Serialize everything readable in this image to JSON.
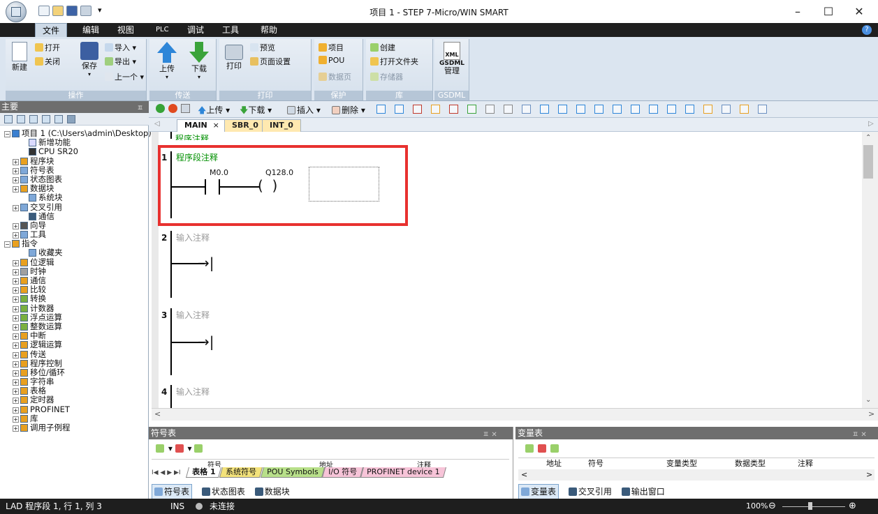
{
  "window": {
    "title": "项目 1 - STEP 7-Micro/WIN SMART",
    "minimize": "–",
    "maximize": "☐",
    "close": "✕"
  },
  "menu": [
    "文件",
    "编辑",
    "视图",
    "PLC",
    "调试",
    "工具",
    "帮助"
  ],
  "ribbon": {
    "operate": {
      "new": "新建",
      "open": "打开",
      "close": "关闭",
      "save": "保存",
      "import": "导入",
      "export": "导出",
      "prev": "上一个",
      "title": "操作"
    },
    "transfer": {
      "upload": "上传",
      "download": "下载",
      "title": "传送"
    },
    "print": {
      "print": "打印",
      "preview": "预览",
      "page_setup": "页面设置",
      "title": "打印"
    },
    "protect": {
      "project": "项目",
      "pou": "POU",
      "data_page": "数据页",
      "title": "保护"
    },
    "library": {
      "create": "创建",
      "open_folder": "打开文件夹",
      "memory": "存储器",
      "title": "库"
    },
    "gsdml": {
      "xml": "XML",
      "manage_line1": "GSDML",
      "manage_line2": "管理",
      "title": "GSDML"
    }
  },
  "left_panel": {
    "title": "主要",
    "tree": [
      {
        "label": "项目 1 (C:\\Users\\admin\\Desktop)",
        "level": 0,
        "toggle": "−",
        "color": "#3a7fd0"
      },
      {
        "label": "新增功能",
        "level": 2,
        "toggle": "",
        "color": "#d9d9ff"
      },
      {
        "label": "CPU SR20",
        "level": 2,
        "toggle": "",
        "color": "#333333"
      },
      {
        "label": "程序块",
        "level": 1,
        "toggle": "+",
        "color": "#e8a020"
      },
      {
        "label": "符号表",
        "level": 1,
        "toggle": "+",
        "color": "#7fa8d8"
      },
      {
        "label": "状态图表",
        "level": 1,
        "toggle": "+",
        "color": "#7fa8d8"
      },
      {
        "label": "数据块",
        "level": 1,
        "toggle": "+",
        "color": "#e8a020"
      },
      {
        "label": "系统块",
        "level": 2,
        "toggle": "",
        "color": "#7fa8d8"
      },
      {
        "label": "交叉引用",
        "level": 1,
        "toggle": "+",
        "color": "#7fa8d8"
      },
      {
        "label": "通信",
        "level": 2,
        "toggle": "",
        "color": "#3a5a7a"
      },
      {
        "label": "向导",
        "level": 1,
        "toggle": "+",
        "color": "#555555"
      },
      {
        "label": "工具",
        "level": 1,
        "toggle": "+",
        "color": "#7fa8d8"
      },
      {
        "label": "指令",
        "level": 0,
        "toggle": "−",
        "color": "#e8a020"
      },
      {
        "label": "收藏夹",
        "level": 2,
        "toggle": "",
        "color": "#7fa8d8"
      },
      {
        "label": "位逻辑",
        "level": 1,
        "toggle": "+",
        "color": "#e8a020"
      },
      {
        "label": "时钟",
        "level": 1,
        "toggle": "+",
        "color": "#a0a0a0"
      },
      {
        "label": "通信",
        "level": 1,
        "toggle": "+",
        "color": "#e8a020"
      },
      {
        "label": "比较",
        "level": 1,
        "toggle": "+",
        "color": "#e8a020"
      },
      {
        "label": "转换",
        "level": 1,
        "toggle": "+",
        "color": "#7ab040"
      },
      {
        "label": "计数器",
        "level": 1,
        "toggle": "+",
        "color": "#7ab040"
      },
      {
        "label": "浮点运算",
        "level": 1,
        "toggle": "+",
        "color": "#7ab040"
      },
      {
        "label": "整数运算",
        "level": 1,
        "toggle": "+",
        "color": "#7ab040"
      },
      {
        "label": "中断",
        "level": 1,
        "toggle": "+",
        "color": "#e8a020"
      },
      {
        "label": "逻辑运算",
        "level": 1,
        "toggle": "+",
        "color": "#e8a020"
      },
      {
        "label": "传送",
        "level": 1,
        "toggle": "+",
        "color": "#e8a020"
      },
      {
        "label": "程序控制",
        "level": 1,
        "toggle": "+",
        "color": "#e8a020"
      },
      {
        "label": "移位/循环",
        "level": 1,
        "toggle": "+",
        "color": "#e8a020"
      },
      {
        "label": "字符串",
        "level": 1,
        "toggle": "+",
        "color": "#e8a020"
      },
      {
        "label": "表格",
        "level": 1,
        "toggle": "+",
        "color": "#e8a020"
      },
      {
        "label": "定时器",
        "level": 1,
        "toggle": "+",
        "color": "#e8a020"
      },
      {
        "label": "PROFINET",
        "level": 1,
        "toggle": "+",
        "color": "#e8a020"
      },
      {
        "label": "库",
        "level": 1,
        "toggle": "+",
        "color": "#e8a020"
      },
      {
        "label": "调用子例程",
        "level": 1,
        "toggle": "+",
        "color": "#e8a020"
      }
    ]
  },
  "editor": {
    "toolbar": {
      "upload": "上传",
      "download": "下载",
      "insert": "插入",
      "delete": "删除"
    },
    "tabs": [
      "MAIN",
      "SBR_0",
      "INT_0"
    ],
    "tab_close": "×",
    "program_comment": "程序注释",
    "networks": [
      {
        "num": "1",
        "comment": "程序段注释",
        "contact": "M0.0",
        "coil": "Q128.0"
      },
      {
        "num": "2",
        "comment": "输入注释"
      },
      {
        "num": "3",
        "comment": "输入注释"
      },
      {
        "num": "4",
        "comment": "输入注释"
      }
    ],
    "highlight_color": "#e8312f"
  },
  "symbol_table": {
    "title": "符号表",
    "col_symbol": "符号",
    "col_address": "地址",
    "col_comment": "注释",
    "subtabs": [
      "表格 1",
      "系统符号",
      "POU Symbols",
      "I/O 符号",
      "PROFINET device 1"
    ],
    "bottom_tabs": [
      "符号表",
      "状态图表",
      "数据块"
    ]
  },
  "var_table": {
    "title": "变量表",
    "columns": [
      "地址",
      "符号",
      "变量类型",
      "数据类型",
      "注释"
    ],
    "bottom_tabs": [
      "变量表",
      "交叉引用",
      "输出窗口"
    ]
  },
  "status": {
    "position": "LAD 程序段 1, 行 1, 列 3",
    "mode": "INS",
    "connection": "未连接",
    "zoom": "100%"
  }
}
